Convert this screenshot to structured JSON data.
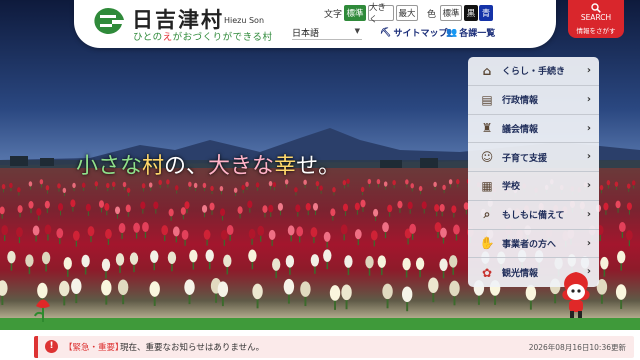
{
  "header": {
    "title": "日吉津村",
    "title_roman": "Hiezu Son",
    "tagline_pre": "ひとの",
    "tagline_em": "え",
    "tagline_post": "がおづくりができる村"
  },
  "toolbar": {
    "text_label": "文字",
    "size_standard": "標準",
    "size_large": "大きく",
    "size_max": "最大",
    "color_label": "色",
    "color_standard": "標準",
    "color_black": "黒",
    "color_blue": "青",
    "language": "日本語",
    "sitemap": "サイトマップ",
    "sections": "各課一覧",
    "search_main": "SEARCH",
    "search_sub": "情報をさがす"
  },
  "hero": {
    "catch_1": "小さな",
    "catch_2": "村",
    "catch_3": "の、",
    "catch_4": "大きな",
    "catch_5": "幸",
    "catch_6": "せ。"
  },
  "menu": {
    "items": [
      {
        "label": "くらし・手続き",
        "icon": "house-icon"
      },
      {
        "label": "行政情報",
        "icon": "document-icon"
      },
      {
        "label": "議会情報",
        "icon": "assembly-icon"
      },
      {
        "label": "子育て支援",
        "icon": "baby-icon"
      },
      {
        "label": "学校",
        "icon": "school-icon"
      },
      {
        "label": "もしもに備えて",
        "icon": "magnifier-icon"
      },
      {
        "label": "事業者の方へ",
        "icon": "handshake-icon"
      },
      {
        "label": "観光情報",
        "icon": "tulip-icon"
      }
    ]
  },
  "alert": {
    "tag": "【緊急・重要】",
    "message": "現在、重要なお知らせはありません。",
    "updated": "2026年08月16日10:36更新"
  },
  "colors": {
    "brand_green": "#2f8a3a",
    "alert_red": "#d33",
    "search_red": "#d9262c",
    "menu_text": "#1e2c59"
  }
}
